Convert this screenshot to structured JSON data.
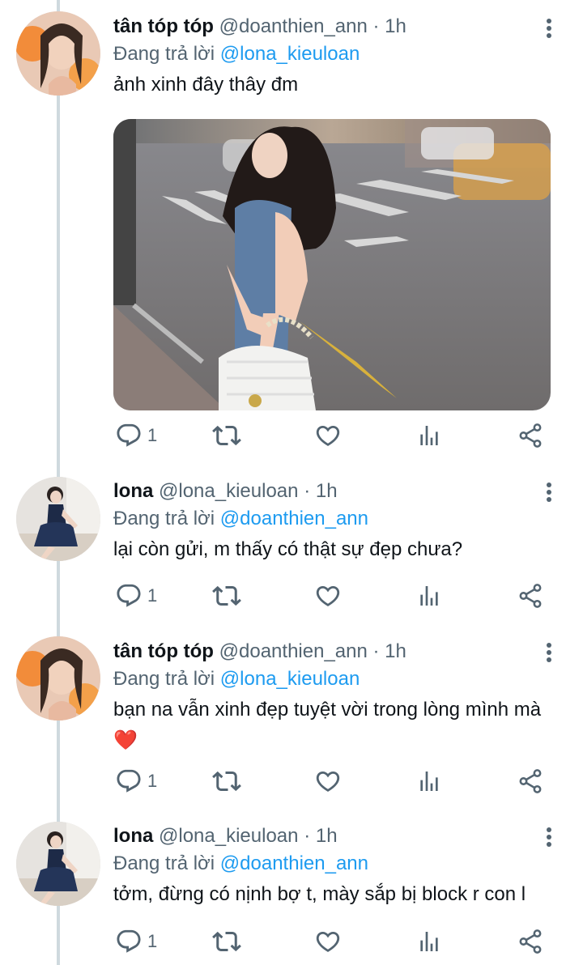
{
  "tweets": [
    {
      "display_name": "tân tóp tóp",
      "handle": "@doanthien_ann",
      "dot": "·",
      "time": "1h",
      "reply_prefix": "Đang trả lời",
      "reply_to": "@lona_kieuloan",
      "text": "ảnh xinh đây thây đm",
      "reply_count": "1",
      "has_media": true
    },
    {
      "display_name": "lona",
      "handle": "@lona_kieuloan",
      "dot": "·",
      "time": "1h",
      "reply_prefix": "Đang trả lời",
      "reply_to": "@doanthien_ann",
      "text": "lại còn gửi, m thấy có thật sự đẹp chưa?",
      "reply_count": "1"
    },
    {
      "display_name": "tân tóp tóp",
      "handle": "@doanthien_ann",
      "dot": "·",
      "time": "1h",
      "reply_prefix": "Đang trả lời",
      "reply_to": "@lona_kieuloan",
      "text": "bạn na vẫn xinh đẹp tuyệt vời trong lòng mình mà",
      "emoji": "❤️",
      "reply_count": "1"
    },
    {
      "display_name": "lona",
      "handle": "@lona_kieuloan",
      "dot": "·",
      "time": "1h",
      "reply_prefix": "Đang trả lời",
      "reply_to": "@doanthien_ann",
      "text": "tởm, đừng có nịnh bợ t, mày sắp bị block r con l",
      "reply_count": "1"
    }
  ],
  "icons": {
    "reply": "reply-icon",
    "retweet": "retweet-icon",
    "like": "heart-icon",
    "views": "analytics-icon",
    "share": "share-icon",
    "more": "more-vertical-icon"
  },
  "colors": {
    "accent": "#1d9bf0",
    "secondary_text": "#536471",
    "thread_line": "#cfd9de"
  }
}
